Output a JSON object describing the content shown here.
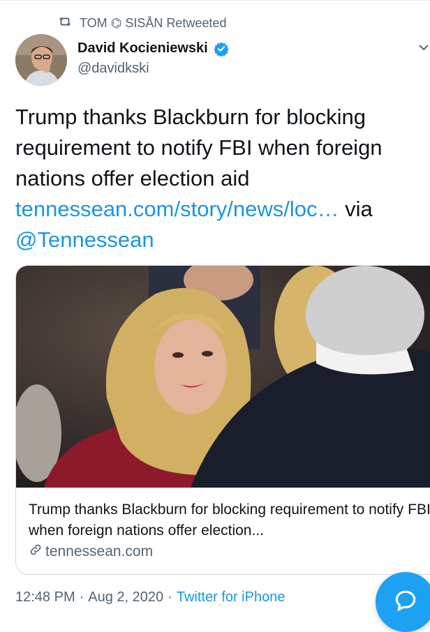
{
  "retweet": {
    "text": "TOM ⌬ SISÅN Retweeted",
    "icon": "retweet-icon"
  },
  "author": {
    "name": "David Kocieniewski",
    "handle": "@davidkski",
    "verified": true,
    "avatar_icon": "avatar"
  },
  "tweet": {
    "line1": "Trump thanks Blackburn for blocking requirement to notify FBI when foreign nations offer election aid",
    "link": "tennessean.com/story/news/loc…",
    "via": " via",
    "mention": "@Tennessean"
  },
  "card": {
    "title": "Trump thanks Blackburn for blocking requirement to notify FBI when foreign nations offer election...",
    "domain": "tennessean.com",
    "domain_icon": "link-icon"
  },
  "meta": {
    "time": "12:48 PM",
    "sep1": "·",
    "date": "Aug 2, 2020",
    "sep2": "·",
    "source": "Twitter for iPhone"
  },
  "colors": {
    "accent": "#1b95e0",
    "fab": "#1da1f2",
    "muted": "#536471"
  },
  "fab": {
    "icon": "compose-reply-icon"
  }
}
